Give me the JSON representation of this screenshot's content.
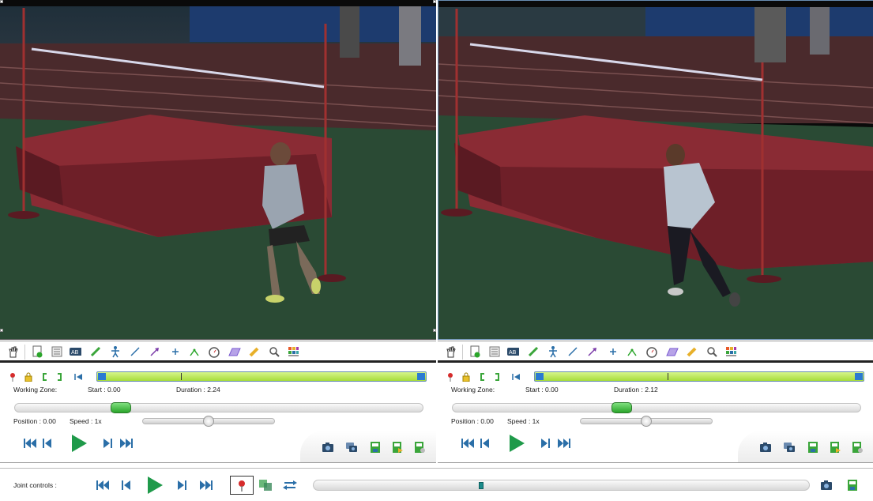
{
  "players": [
    {
      "id": "left",
      "tools": [
        "hand-icon",
        "add-keyframe-icon",
        "comment-icon",
        "label-ab-icon",
        "pencil-icon",
        "human-model-icon",
        "line-icon",
        "arrow-icon",
        "cross-marker-icon",
        "angle-icon",
        "chronometer-icon",
        "grid-icon",
        "marker-pen-icon",
        "magnifier-icon",
        "color-profile-icon"
      ],
      "working_zone_label": "Working Zone:",
      "start_text": "Start : 0.00",
      "duration_text": "Duration : 2.24",
      "position_text": "Position : 0.00",
      "speed_text": "Speed : 1x",
      "position_fraction": 0.247,
      "zone_tick_fraction": 0.255,
      "speed_fraction": 0.5
    },
    {
      "id": "right",
      "tools": [
        "hand-icon",
        "add-keyframe-icon",
        "comment-icon",
        "label-ab-icon",
        "pencil-icon",
        "human-model-icon",
        "line-icon",
        "arrow-icon",
        "cross-marker-icon",
        "angle-icon",
        "chronometer-icon",
        "grid-icon",
        "marker-pen-icon",
        "magnifier-icon",
        "color-profile-icon"
      ],
      "working_zone_label": "Working Zone:",
      "start_text": "Start : 0.00",
      "duration_text": "Duration : 2.12",
      "position_text": "Position : 0.00",
      "speed_text": "Speed : 1x",
      "position_fraction": 0.41,
      "zone_tick_fraction": 0.405,
      "speed_fraction": 0.5
    }
  ],
  "joint": {
    "label": "Joint controls :",
    "position_fraction": 0.337
  },
  "colors": {
    "play_green": "#1f9a4a",
    "nav_blue": "#2b6fa8",
    "zone_green": "#b9e85a",
    "zone_blue": "#2b7ad1",
    "marker_red": "#d62c2c"
  }
}
